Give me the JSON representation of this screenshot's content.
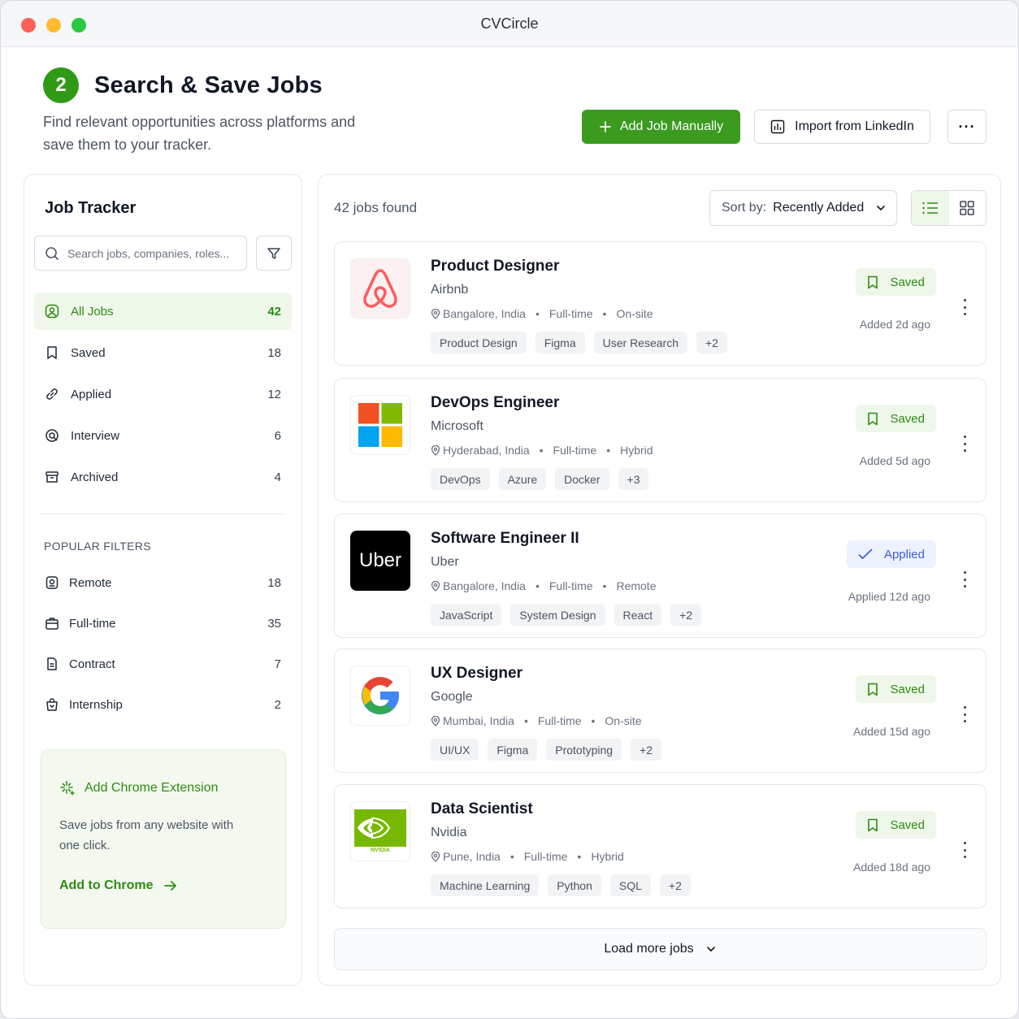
{
  "window": {
    "title": "CVCircle"
  },
  "header": {
    "step": "2",
    "title": "Search & Save Jobs",
    "subtitle": "Find relevant opportunities across platforms and save them to your tracker.",
    "add_button": "Add Job Manually",
    "import_button": "Import from LinkedIn",
    "more_icon": "ellipsis-icon"
  },
  "sidebar": {
    "title": "Job Tracker",
    "search_placeholder": "Search jobs, companies, roles...",
    "nav": [
      {
        "label": "All Jobs",
        "count": "42",
        "icon": "user-circle-icon"
      },
      {
        "label": "Saved",
        "count": "18",
        "icon": "bookmark-icon"
      },
      {
        "label": "Applied",
        "count": "12",
        "icon": "link-icon"
      },
      {
        "label": "Interview",
        "count": "6",
        "icon": "target-icon"
      },
      {
        "label": "Archived",
        "count": "4",
        "icon": "archive-icon"
      }
    ],
    "popular_title": "POPULAR FILTERS",
    "popular": [
      {
        "label": "Remote",
        "count": "18",
        "icon": "remote-icon"
      },
      {
        "label": "Full-time",
        "count": "35",
        "icon": "briefcase-icon"
      },
      {
        "label": "Contract",
        "count": "7",
        "icon": "document-icon"
      },
      {
        "label": "Internship",
        "count": "2",
        "icon": "bag-icon"
      }
    ],
    "extension": {
      "title": "Add Chrome Extension",
      "description": "Save jobs from any website with one click.",
      "link": "Add to Chrome"
    }
  },
  "main": {
    "found": "42 jobs found",
    "sort_label": "Sort by:",
    "sort_value": "Recently Added",
    "load_more": "Load more jobs",
    "jobs": [
      {
        "title": "Product Designer",
        "company": "Airbnb",
        "location": "Bangalore, India",
        "type": "Full-time",
        "mode": "On-site",
        "tags": [
          "Product Design",
          "Figma",
          "User Research",
          "+2"
        ],
        "status": "Saved",
        "added": "Added 2d ago"
      },
      {
        "title": "DevOps Engineer",
        "company": "Microsoft",
        "location": "Hyderabad, India",
        "type": "Full-time",
        "mode": "Hybrid",
        "tags": [
          "DevOps",
          "Azure",
          "Docker",
          "+3"
        ],
        "status": "Saved",
        "added": "Added 5d ago"
      },
      {
        "title": "Software Engineer II",
        "company": "Uber",
        "location": "Bangalore, India",
        "type": "Full-time",
        "mode": "Remote",
        "tags": [
          "JavaScript",
          "System Design",
          "React",
          "+2"
        ],
        "status": "Applied",
        "added": "Applied 12d ago",
        "logo_text": "Uber"
      },
      {
        "title": "UX Designer",
        "company": "Google",
        "location": "Mumbai, India",
        "type": "Full-time",
        "mode": "On-site",
        "tags": [
          "UI/UX",
          "Figma",
          "Prototyping",
          "+2"
        ],
        "status": "Saved",
        "added": "Added 15d ago"
      },
      {
        "title": "Data Scientist",
        "company": "Nvidia",
        "location": "Pune, India",
        "type": "Full-time",
        "mode": "Hybrid",
        "tags": [
          "Machine Learning",
          "Python",
          "SQL",
          "+2"
        ],
        "status": "Saved",
        "added": "Added 18d ago",
        "logo_text": "NVIDIA"
      }
    ]
  },
  "colors": {
    "accent": "#3a9b1f",
    "saved": "#2f8a14",
    "applied": "#3b5bdb"
  }
}
